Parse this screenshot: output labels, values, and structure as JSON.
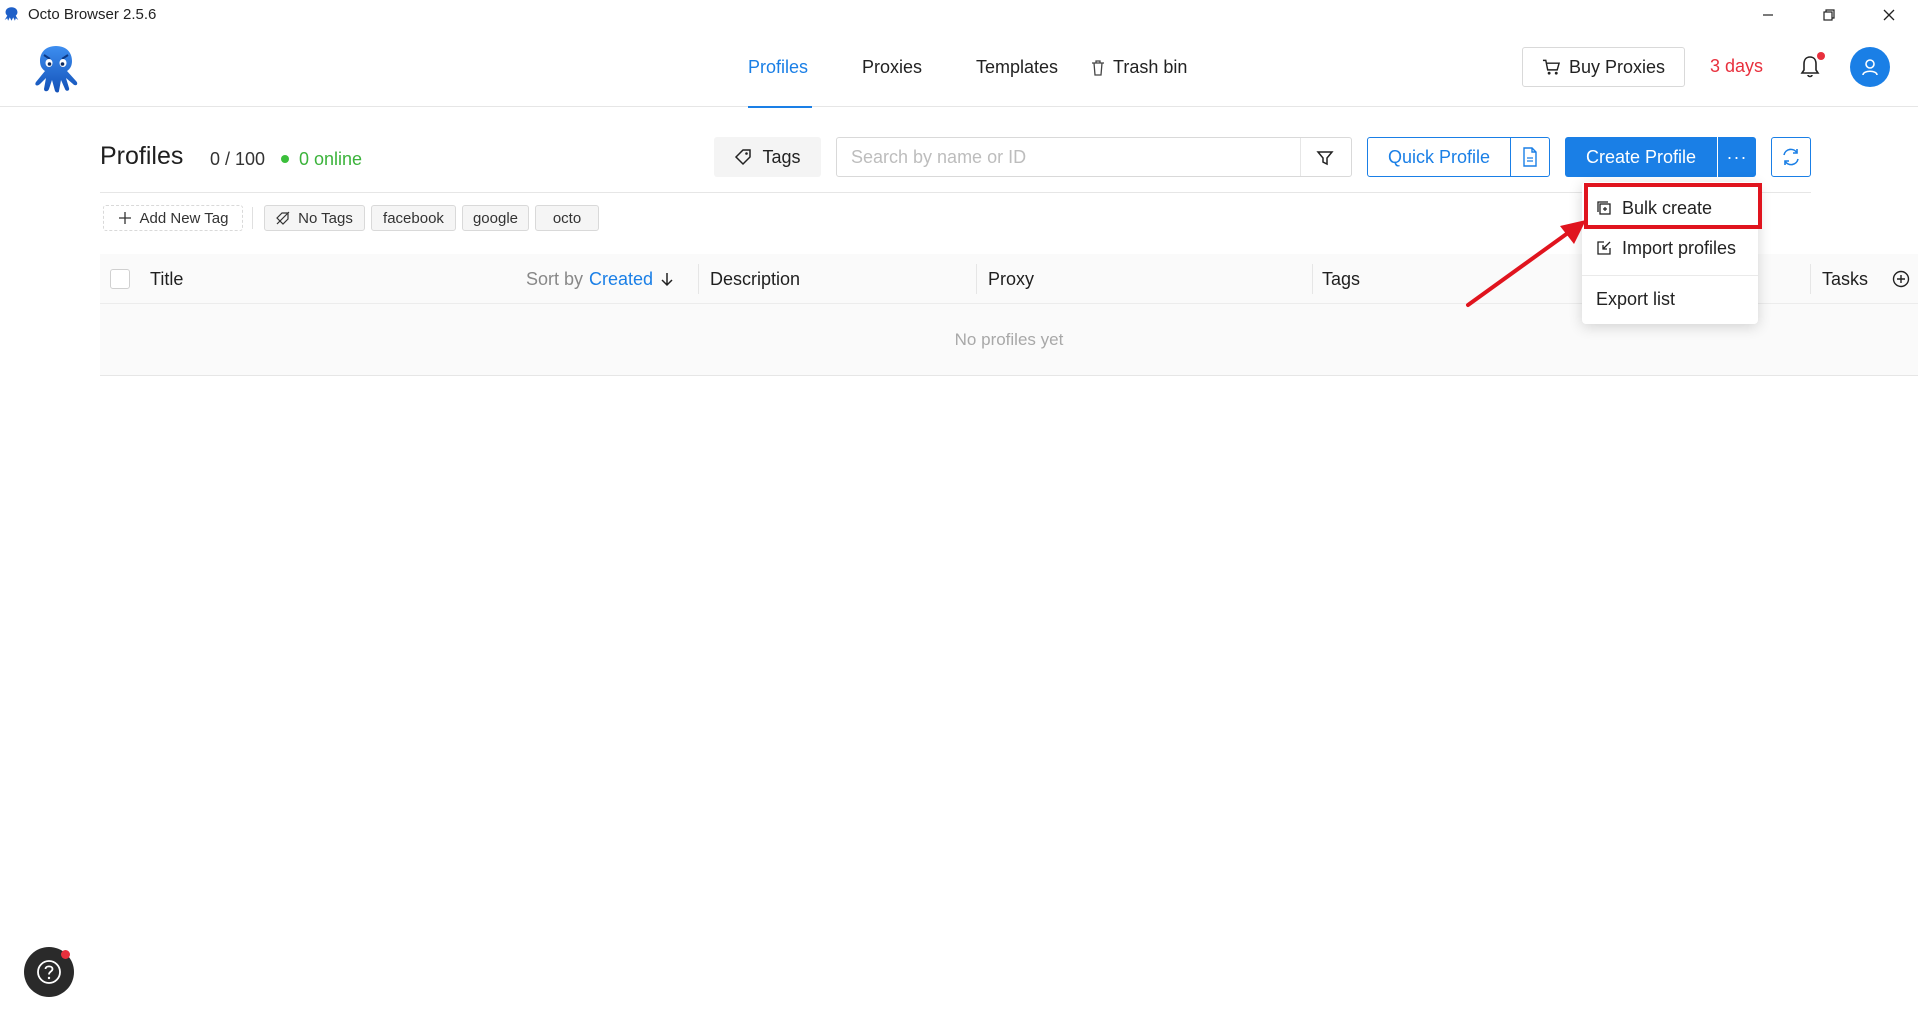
{
  "window": {
    "title": "Octo Browser 2.5.6"
  },
  "nav": {
    "tabs": [
      {
        "label": "Profiles",
        "active": true
      },
      {
        "label": "Proxies",
        "active": false
      },
      {
        "label": "Templates",
        "active": false
      },
      {
        "label": "Trash bin",
        "active": false,
        "icon": "trash-icon"
      }
    ]
  },
  "header": {
    "buy_proxies_label": "Buy Proxies",
    "trial_days": "3 days",
    "notification_icon": "bell-icon",
    "avatar_icon": "user-icon"
  },
  "toolbar": {
    "title": "Profiles",
    "count": "0 / 100",
    "online": "0 online",
    "tags_label": "Tags",
    "search_placeholder": "Search by name or ID",
    "search_value": "",
    "quick_profile_label": "Quick Profile",
    "create_profile_label": "Create Profile",
    "more_label": "···"
  },
  "tags": {
    "add_label": "Add New Tag",
    "no_tags_label": "No Tags",
    "items": [
      "facebook",
      "google",
      "octo"
    ]
  },
  "table": {
    "columns": {
      "title": "Title",
      "sort_by": "Sort by",
      "sort_value": "Created",
      "description": "Description",
      "proxy": "Proxy",
      "tags": "Tags",
      "tasks": "Tasks"
    },
    "empty_text": "No profiles yet"
  },
  "dropdown": {
    "items": [
      {
        "label": "Bulk create",
        "icon": "bulk-create-icon"
      },
      {
        "label": "Import profiles",
        "icon": "import-icon"
      },
      {
        "label": "Export list",
        "icon": ""
      }
    ]
  },
  "colors": {
    "accent": "#1a7fe6",
    "danger": "#e8303d",
    "online": "#3bb33b",
    "annotation": "#e0141e"
  }
}
